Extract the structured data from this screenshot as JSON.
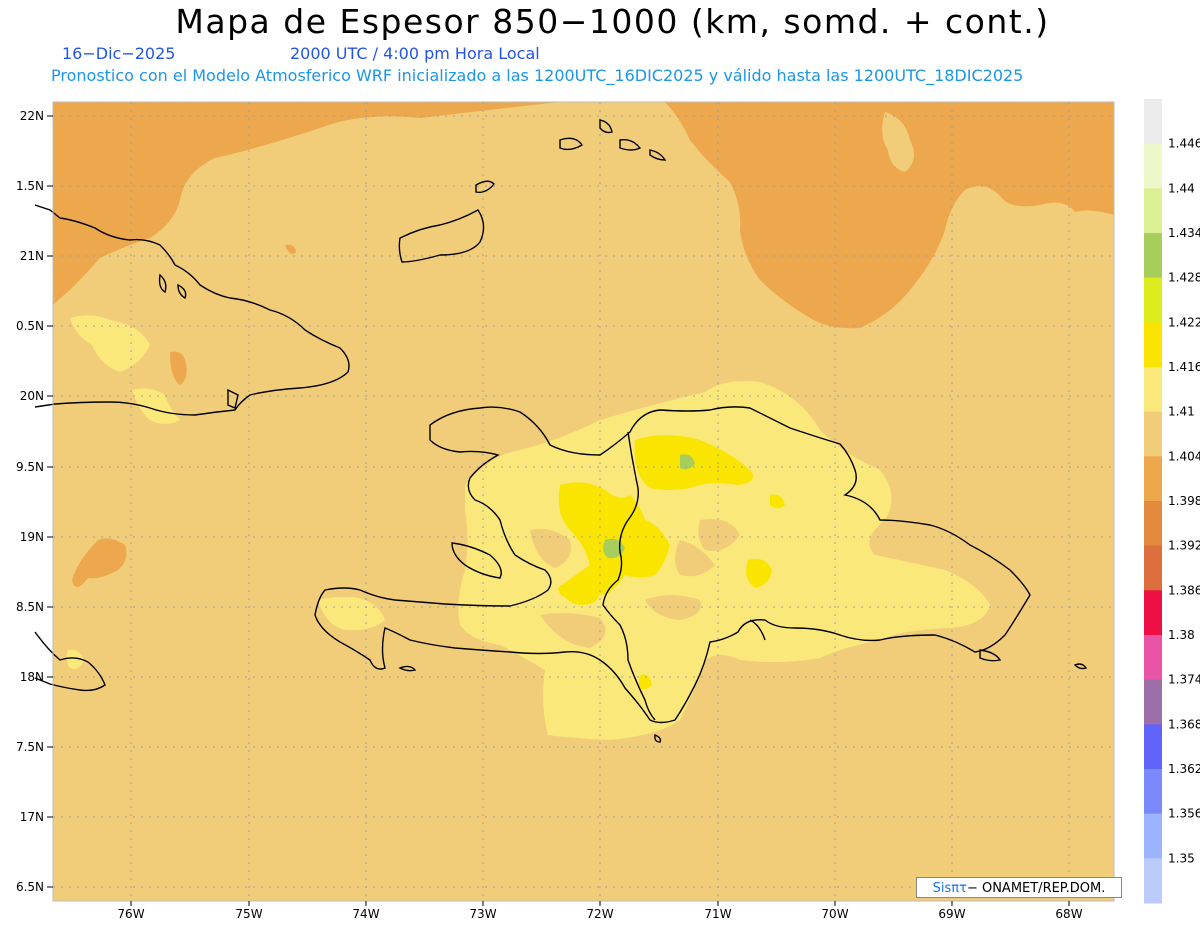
{
  "title": "Mapa de Espesor 850−1000 (km, somd. + cont.)",
  "date": "16−Dic−2025",
  "time": "2000 UTC / 4:00 pm Hora Local",
  "forecast": "Pronostico con el Modelo Atmosferico WRF inicializado a las 1200UTC_16DIC2025 y válido hasta las  1200UTC_18DIC2025",
  "credit_logo": "Sisπτ",
  "credit_text": "− ONAMET/REP.DOM.",
  "lat_labels": [
    "22N",
    "1.5N",
    "21N",
    "0.5N",
    "20N",
    "9.5N",
    "19N",
    "8.5N",
    "18N",
    "7.5N",
    "17N",
    "6.5N"
  ],
  "lon_labels": [
    "76W",
    "75W",
    "74W",
    "73W",
    "72W",
    "71W",
    "70W",
    "69W",
    "68W"
  ],
  "colorbar": {
    "labels": [
      "1.446",
      "1.44",
      "1.434",
      "1.428",
      "1.422",
      "1.416",
      "1.41",
      "1.404",
      "1.398",
      "1.392",
      "1.386",
      "1.38",
      "1.374",
      "1.368",
      "1.362",
      "1.356",
      "1.35"
    ],
    "colors": [
      "#ebebeb",
      "#eef7c9",
      "#dcf193",
      "#a7cd5b",
      "#dcec1d",
      "#fae500",
      "#fbe87b",
      "#f1cd7a",
      "#eda74c",
      "#e2893e",
      "#dd6f3e",
      "#ee0f45",
      "#e954a7",
      "#9d6fa9",
      "#6164fb",
      "#7a8afb",
      "#9bb4fb",
      "#bacbfc"
    ]
  },
  "colors": {
    "bg_sea": "#f1cd7a",
    "cool": "#eda74c",
    "light_yellow": "#fbe87b",
    "yellow": "#fae500",
    "green": "#a7cd5b"
  }
}
